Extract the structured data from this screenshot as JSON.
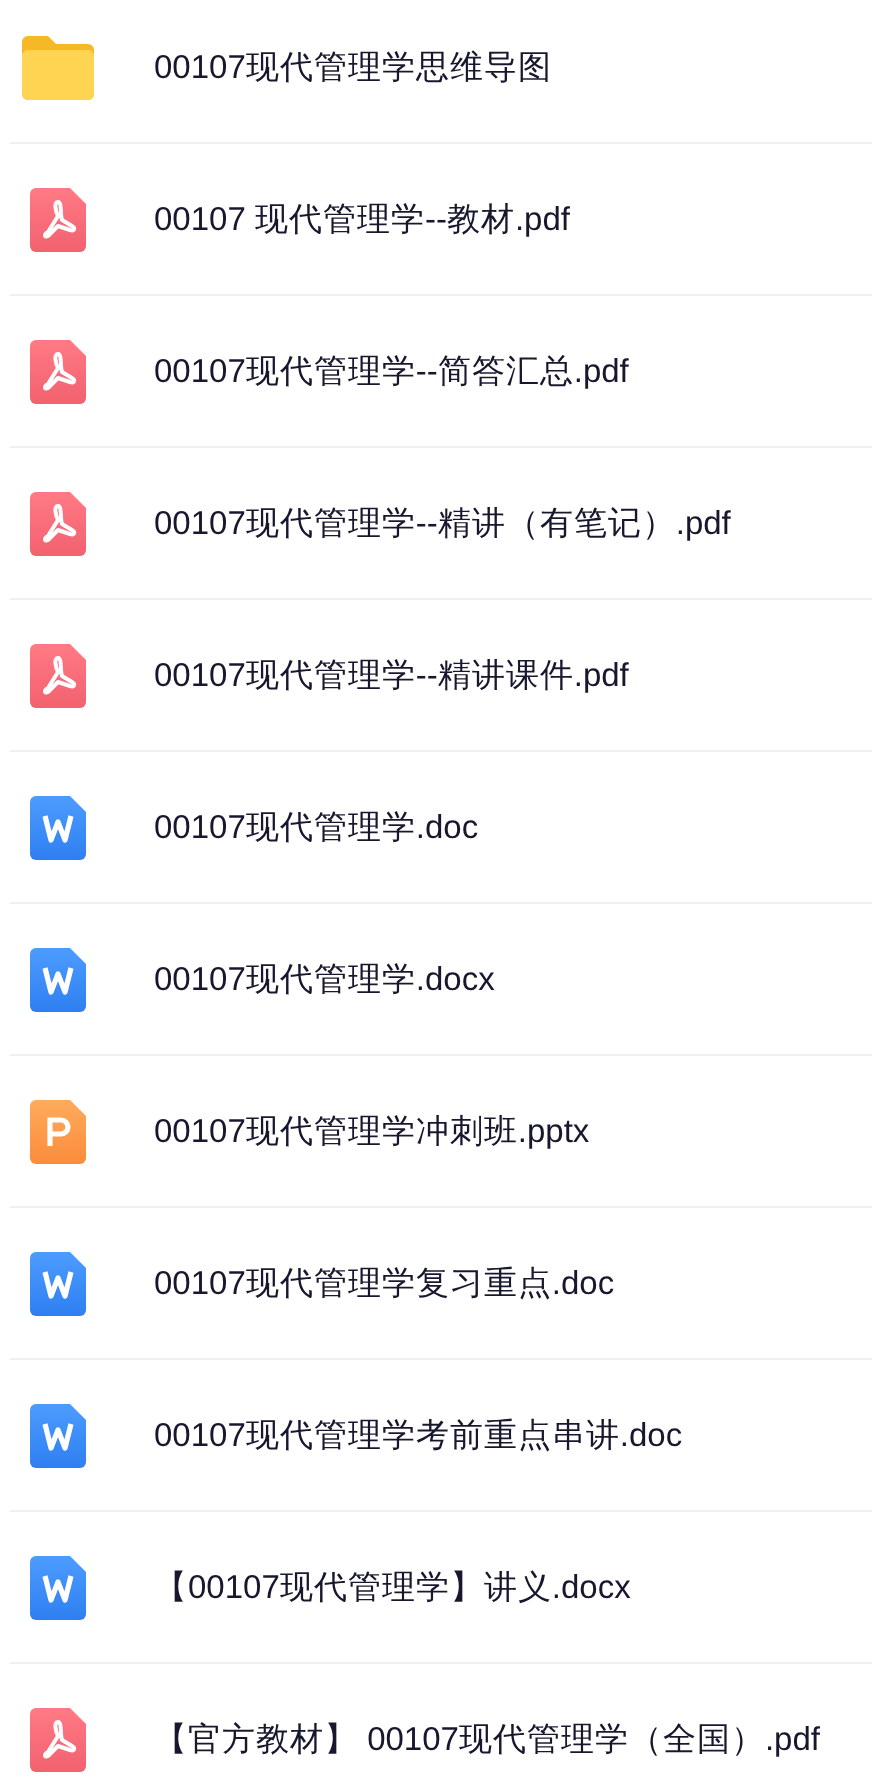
{
  "files": [
    {
      "kind": "folder",
      "name": "00107现代管理学思维导图"
    },
    {
      "kind": "pdf",
      "name": "00107 现代管理学--教材.pdf"
    },
    {
      "kind": "pdf",
      "name": "00107现代管理学--简答汇总.pdf"
    },
    {
      "kind": "pdf",
      "name": "00107现代管理学--精讲（有笔记）.pdf"
    },
    {
      "kind": "pdf",
      "name": "00107现代管理学--精讲课件.pdf"
    },
    {
      "kind": "word",
      "name": "00107现代管理学.doc"
    },
    {
      "kind": "word",
      "name": "00107现代管理学.docx"
    },
    {
      "kind": "ppt",
      "name": "00107现代管理学冲刺班.pptx"
    },
    {
      "kind": "word",
      "name": "00107现代管理学复习重点.doc"
    },
    {
      "kind": "word",
      "name": "00107现代管理学考前重点串讲.doc"
    },
    {
      "kind": "word",
      "name": "【00107现代管理学】讲义.docx"
    },
    {
      "kind": "pdf",
      "name": "【官方教材】 00107现代管理学（全国）.pdf"
    }
  ]
}
